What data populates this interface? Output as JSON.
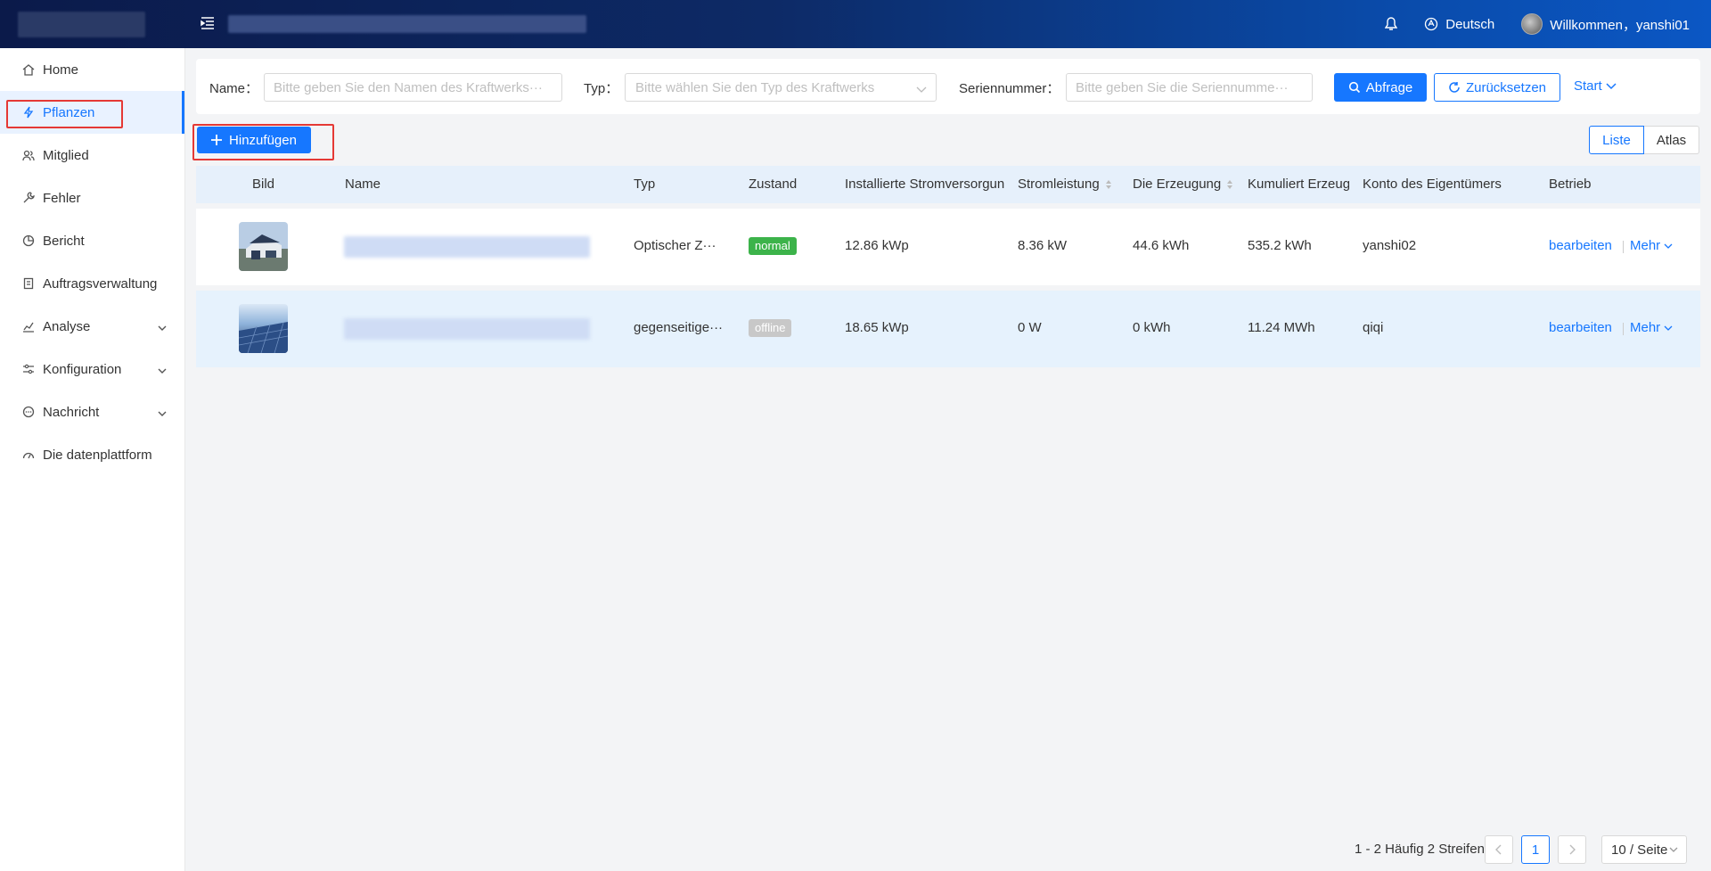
{
  "header": {
    "language": "Deutsch",
    "welcome": "Willkommen，yanshi01"
  },
  "sidebar": {
    "items": [
      {
        "label": "Home",
        "icon": "home-icon"
      },
      {
        "label": "Pflanzen",
        "icon": "bolt-icon",
        "active": true
      },
      {
        "label": "Mitglied",
        "icon": "users-icon"
      },
      {
        "label": "Fehler",
        "icon": "wrench-icon"
      },
      {
        "label": "Bericht",
        "icon": "pie-icon"
      },
      {
        "label": "Auftragsverwaltung",
        "icon": "clipboard-icon"
      },
      {
        "label": "Analyse",
        "icon": "chart-icon",
        "expandable": true
      },
      {
        "label": "Konfiguration",
        "icon": "sliders-icon",
        "expandable": true
      },
      {
        "label": "Nachricht",
        "icon": "message-icon",
        "expandable": true
      },
      {
        "label": "Die datenplattform",
        "icon": "dashboard-icon"
      }
    ]
  },
  "filters": {
    "name_label": "Name",
    "name_placeholder": "Bitte geben Sie den Namen des Kraftwerks···",
    "type_label": "Typ",
    "type_placeholder": "Bitte wählen Sie den Typ des Kraftwerks",
    "serial_label": "Seriennummer",
    "serial_placeholder": "Bitte geben Sie die Seriennumme···",
    "query_button": "Abfrage",
    "reset_button": "Zurücksetzen",
    "start_link": "Start"
  },
  "toolbar": {
    "add_button": "Hinzufügen",
    "view_list": "Liste",
    "view_atlas": "Atlas"
  },
  "table": {
    "columns": [
      "Bild",
      "Name",
      "Typ",
      "Zustand",
      "Installierte Stromversorgun",
      "Stromleistung",
      "Die Erzeugung",
      "Kumuliert Erzeug",
      "Konto des Eigentümers",
      "Betrieb"
    ],
    "rows": [
      {
        "type": "Optischer Z···",
        "status": "normal",
        "status_color": "#3cb34a",
        "installed": "12.86 kWp",
        "power": "8.36 kW",
        "generation": "44.6 kWh",
        "cumulative": "535.2 kWh",
        "owner": "yanshi02",
        "edit": "bearbeiten",
        "more": "Mehr"
      },
      {
        "type": "gegenseitige···",
        "status": "offline",
        "status_color": "#c8c8c8",
        "installed": "18.65 kWp",
        "power": "0 W",
        "generation": "0 kWh",
        "cumulative": "11.24 MWh",
        "owner": "qiqi",
        "edit": "bearbeiten",
        "more": "Mehr"
      }
    ]
  },
  "pagination": {
    "summary": "1 - 2 Häufig 2 Streifen",
    "current_page": "1",
    "page_size": "10 / Seite"
  },
  "colors": {
    "primary": "#1677ff",
    "highlight_box": "#e53935"
  }
}
